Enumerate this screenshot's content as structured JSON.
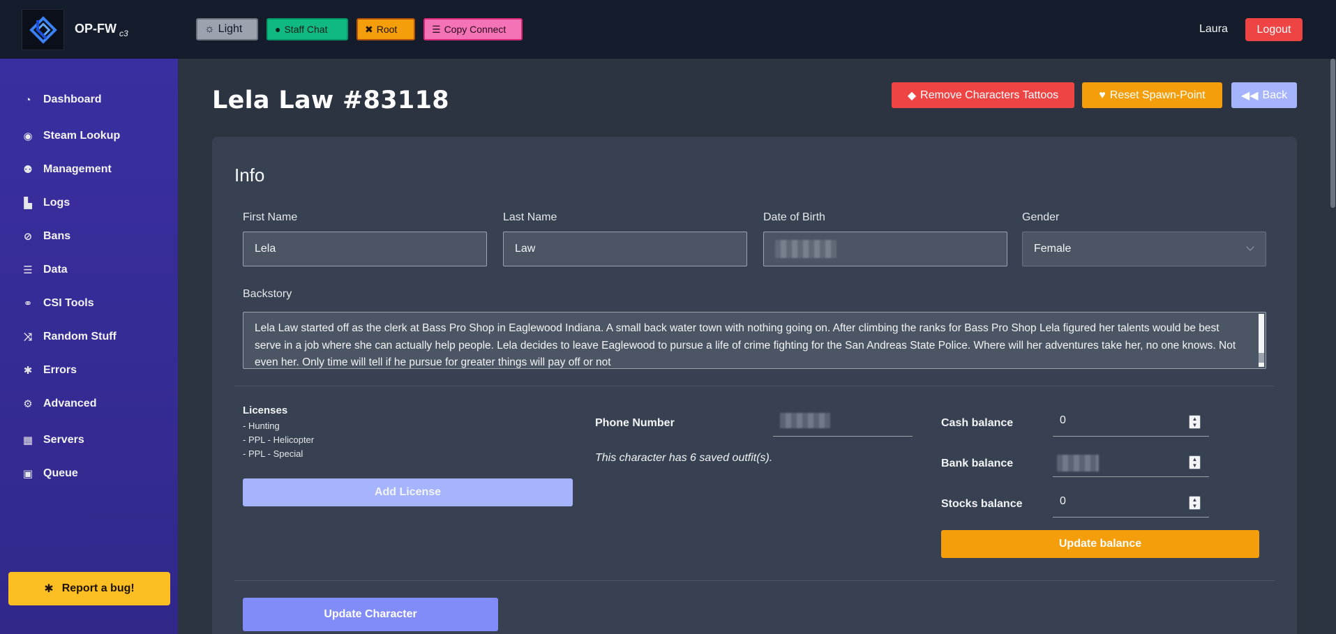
{
  "header": {
    "brand": "OP-FW",
    "brand_sub": "c3",
    "buttons": {
      "light": "Light",
      "staff_chat": "Staff Chat",
      "root": "Root",
      "copy_connect": "Copy Connect"
    },
    "user": "Laura",
    "logout": "Logout"
  },
  "sidebar": {
    "items": [
      {
        "label": "Dashboard",
        "icon": "gauge-icon"
      },
      {
        "label": "Steam Lookup",
        "icon": "steam-icon"
      },
      {
        "label": "Management",
        "icon": "users-icon"
      },
      {
        "label": "Logs",
        "icon": "boxes-icon"
      },
      {
        "label": "Bans",
        "icon": "user-slash-icon"
      },
      {
        "label": "Data",
        "icon": "database-icon"
      },
      {
        "label": "CSI Tools",
        "icon": "handshake-icon"
      },
      {
        "label": "Random Stuff",
        "icon": "random-icon"
      },
      {
        "label": "Errors",
        "icon": "bug-icon"
      },
      {
        "label": "Advanced",
        "icon": "cogs-icon"
      },
      {
        "label": "Servers",
        "icon": "building-icon"
      },
      {
        "label": "Queue",
        "icon": "train-icon"
      }
    ],
    "report_bug": "Report a bug!"
  },
  "page": {
    "title": "Lela Law #83118",
    "actions": {
      "remove_tattoos": "Remove Characters Tattoos",
      "reset_spawn": "Reset Spawn-Point",
      "back": "Back"
    }
  },
  "info": {
    "heading": "Info",
    "first_name_label": "First Name",
    "first_name": "Lela",
    "last_name_label": "Last Name",
    "last_name": "Law",
    "dob_label": "Date of Birth",
    "gender_label": "Gender",
    "gender": "Female",
    "backstory_label": "Backstory",
    "backstory": "Lela Law started off as the clerk at Bass Pro Shop in Eaglewood Indiana. A small back water town with nothing going on. After climbing the ranks for Bass Pro Shop Lela figured her talents would be best serve in a job where she can actually help people. Lela decides to leave Eaglewood to pursue a life of crime fighting for the San Andreas State Police. Where will her adventures take her, no one knows. Not even her. Only time will tell if he pursue for greater things will pay off or not"
  },
  "licenses": {
    "title": "Licenses",
    "items": [
      "-  Hunting",
      "-  PPL - Helicopter",
      "-  PPL - Special"
    ],
    "add_button": "Add License"
  },
  "phone": {
    "label": "Phone Number",
    "outfits_note": "This character has 6 saved outfit(s)."
  },
  "balances": {
    "cash_label": "Cash balance",
    "cash": "0",
    "bank_label": "Bank balance",
    "stocks_label": "Stocks balance",
    "stocks": "0",
    "update_button": "Update balance"
  },
  "update_character": "Update Character",
  "colors": {
    "accent_indigo": "#818cf8",
    "danger": "#ef4444",
    "warning": "#f59e0b",
    "sidebar": "#3a2fa0"
  }
}
